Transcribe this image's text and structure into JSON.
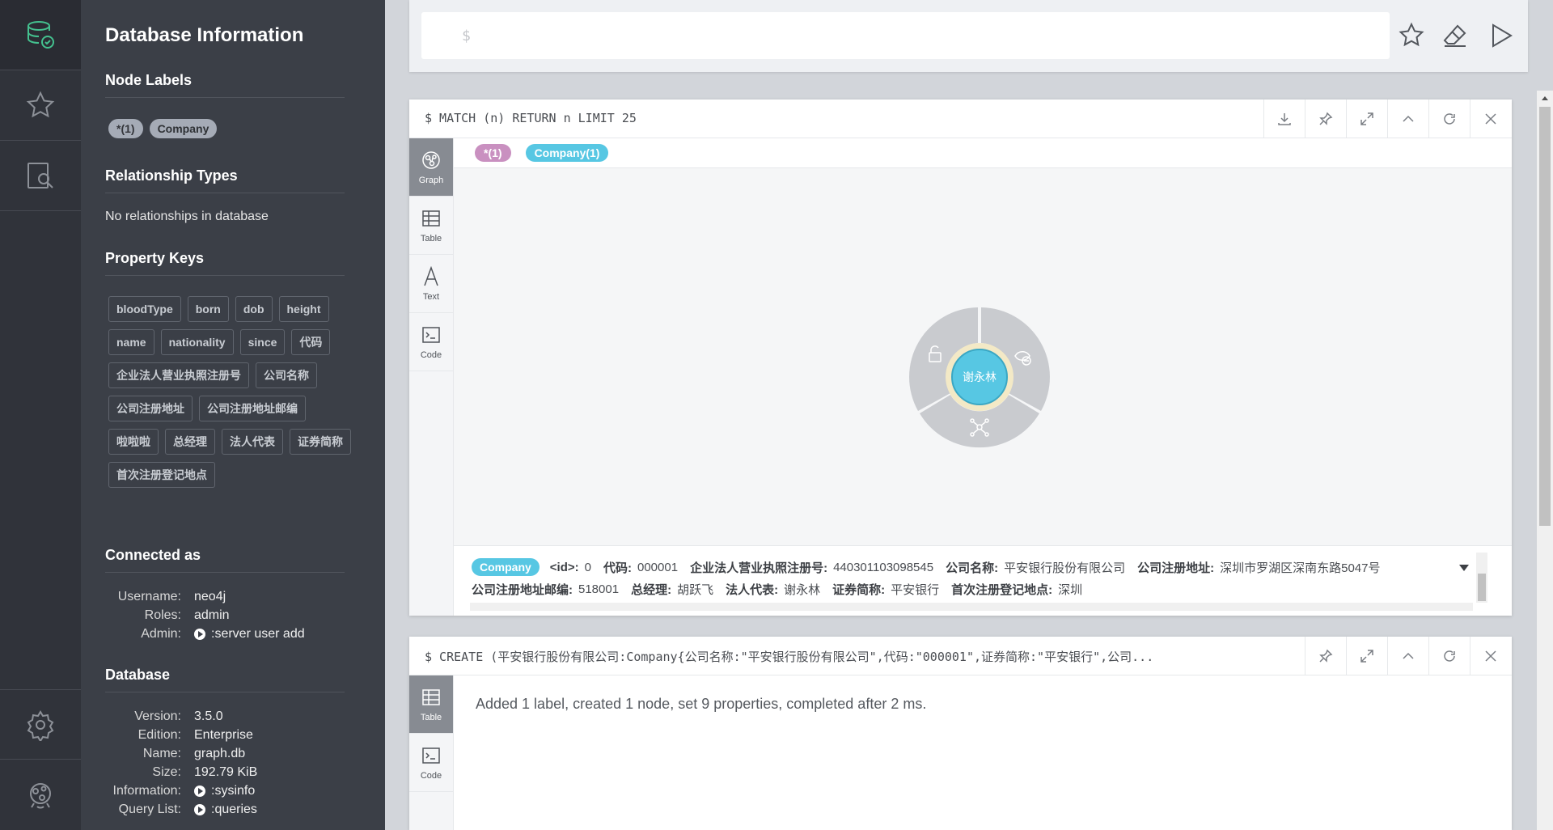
{
  "drawer": {
    "title": "Database Information",
    "node_labels_heading": "Node Labels",
    "node_labels": [
      "*(1)",
      "Company"
    ],
    "rel_types_heading": "Relationship Types",
    "rel_types_empty": "No relationships in database",
    "property_keys_heading": "Property Keys",
    "property_keys": [
      "bloodType",
      "born",
      "dob",
      "height",
      "name",
      "nationality",
      "since",
      "代码",
      "企业法人营业执照注册号",
      "公司名称",
      "公司注册地址",
      "公司注册地址邮编",
      "啦啦啦",
      "总经理",
      "法人代表",
      "证券简称",
      "首次注册登记地点"
    ],
    "connected_heading": "Connected as",
    "connected": {
      "username_k": "Username:",
      "username_v": "neo4j",
      "roles_k": "Roles:",
      "roles_v": "admin",
      "admin_k": "Admin:",
      "admin_v": ":server user add"
    },
    "database_heading": "Database",
    "database": {
      "version_k": "Version:",
      "version_v": "3.5.0",
      "edition_k": "Edition:",
      "edition_v": "Enterprise",
      "name_k": "Name:",
      "name_v": "graph.db",
      "size_k": "Size:",
      "size_v": "192.79 KiB",
      "info_k": "Information:",
      "info_v": ":sysinfo",
      "query_k": "Query List:",
      "query_v": ":queries"
    }
  },
  "editor": {
    "prompt": "$"
  },
  "frame1": {
    "query": "$ MATCH (n) RETURN n LIMIT 25",
    "tabs": {
      "graph": "Graph",
      "table": "Table",
      "text": "Text",
      "code": "Code"
    },
    "legend": [
      "*(1)",
      "Company(1)"
    ],
    "node_label": "谢永林",
    "inspector": {
      "label": "Company",
      "line1": [
        {
          "k": "<id>:",
          "v": "0"
        },
        {
          "k": "代码:",
          "v": "000001"
        },
        {
          "k": "企业法人营业执照注册号:",
          "v": "440301103098545"
        },
        {
          "k": "公司名称:",
          "v": "平安银行股份有限公司"
        },
        {
          "k": "公司注册地址:",
          "v": "深圳市罗湖区深南东路5047号"
        }
      ],
      "line2": [
        {
          "k": "公司注册地址邮编:",
          "v": "518001"
        },
        {
          "k": "总经理:",
          "v": "胡跃飞"
        },
        {
          "k": "法人代表:",
          "v": "谢永林"
        },
        {
          "k": "证券简称:",
          "v": "平安银行"
        },
        {
          "k": "首次注册登记地点:",
          "v": "深圳"
        }
      ]
    }
  },
  "frame2": {
    "query": "$ CREATE (平安银行股份有限公司:Company{公司名称:\"平安银行股份有限公司\",代码:\"000001\",证券简称:\"平安银行\",公司...",
    "tabs": {
      "table": "Table",
      "code": "Code"
    },
    "result": "Added 1 label, created 1 node, set 9 properties, completed after 2 ms."
  },
  "colors": {
    "rail": "#30333a",
    "drawer": "#3b3f47",
    "node_fill": "#57c7e3",
    "all_label": "#c990c0",
    "ring": "#c9cbcf"
  }
}
